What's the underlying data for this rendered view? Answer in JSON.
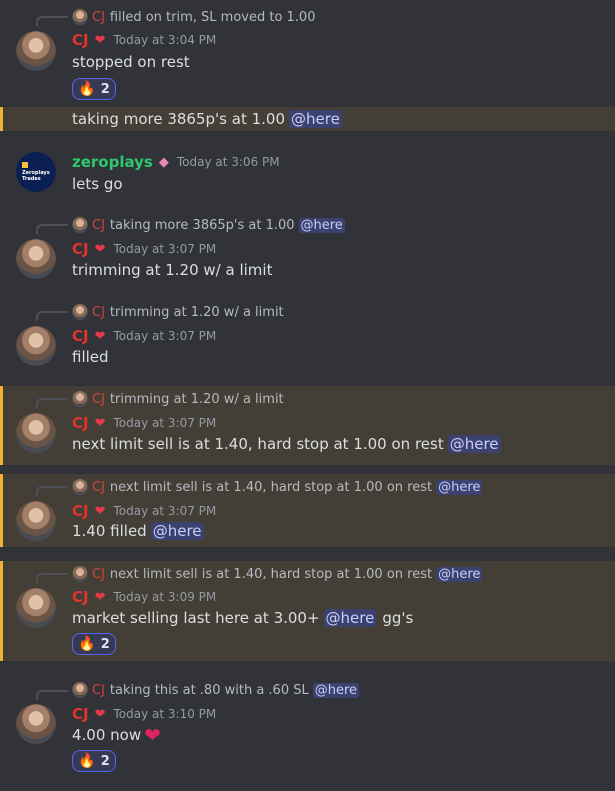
{
  "users": {
    "cj": {
      "name": "CJ",
      "badge": "❤"
    },
    "zero": {
      "name": "zeroplays",
      "badge": "◆",
      "avatar_text": "Zeroplays Trades"
    }
  },
  "reaction": {
    "icon": "🔥",
    "count": "2"
  },
  "messages": [
    {
      "reply": {
        "name": "CJ",
        "text": "filled on trim, SL moved to 1.00",
        "mention": ""
      },
      "timestamp": "Today at 3:04 PM",
      "text": "stopped on rest"
    },
    {
      "text": "taking more 3865p's at 1.00",
      "mention": "@here"
    },
    {
      "timestamp": "Today at 3:06 PM",
      "text": "lets go"
    },
    {
      "reply": {
        "name": "CJ",
        "text": "taking more 3865p's at 1.00",
        "mention": "@here"
      },
      "timestamp": "Today at 3:07 PM",
      "text": "trimming at 1.20 w/ a limit"
    },
    {
      "reply": {
        "name": "CJ",
        "text": "trimming at 1.20 w/ a limit",
        "mention": ""
      },
      "timestamp": "Today at 3:07 PM",
      "text": "filled"
    },
    {
      "reply": {
        "name": "CJ",
        "text": "trimming at 1.20 w/ a limit",
        "mention": ""
      },
      "timestamp": "Today at 3:07 PM",
      "text": "next limit sell is at 1.40, hard stop at 1.00 on rest",
      "mention": "@here"
    },
    {
      "reply": {
        "name": "CJ",
        "text": "next limit sell is at 1.40, hard stop at 1.00 on rest",
        "mention": "@here"
      },
      "timestamp": "Today at 3:07 PM",
      "text": "1.40 filled",
      "mention": "@here"
    },
    {
      "reply": {
        "name": "CJ",
        "text": "next limit sell is at 1.40, hard stop at 1.00 on rest",
        "mention": "@here"
      },
      "timestamp": "Today at 3:09 PM",
      "text": "market selling last here at 3.00+",
      "mention": "@here",
      "after": "gg's"
    },
    {
      "reply": {
        "name": "CJ",
        "text": "taking this at .80 with a .60 SL",
        "mention": "@here"
      },
      "timestamp": "Today at 3:10 PM",
      "text": "4.00 now",
      "emoji": "❤"
    }
  ]
}
